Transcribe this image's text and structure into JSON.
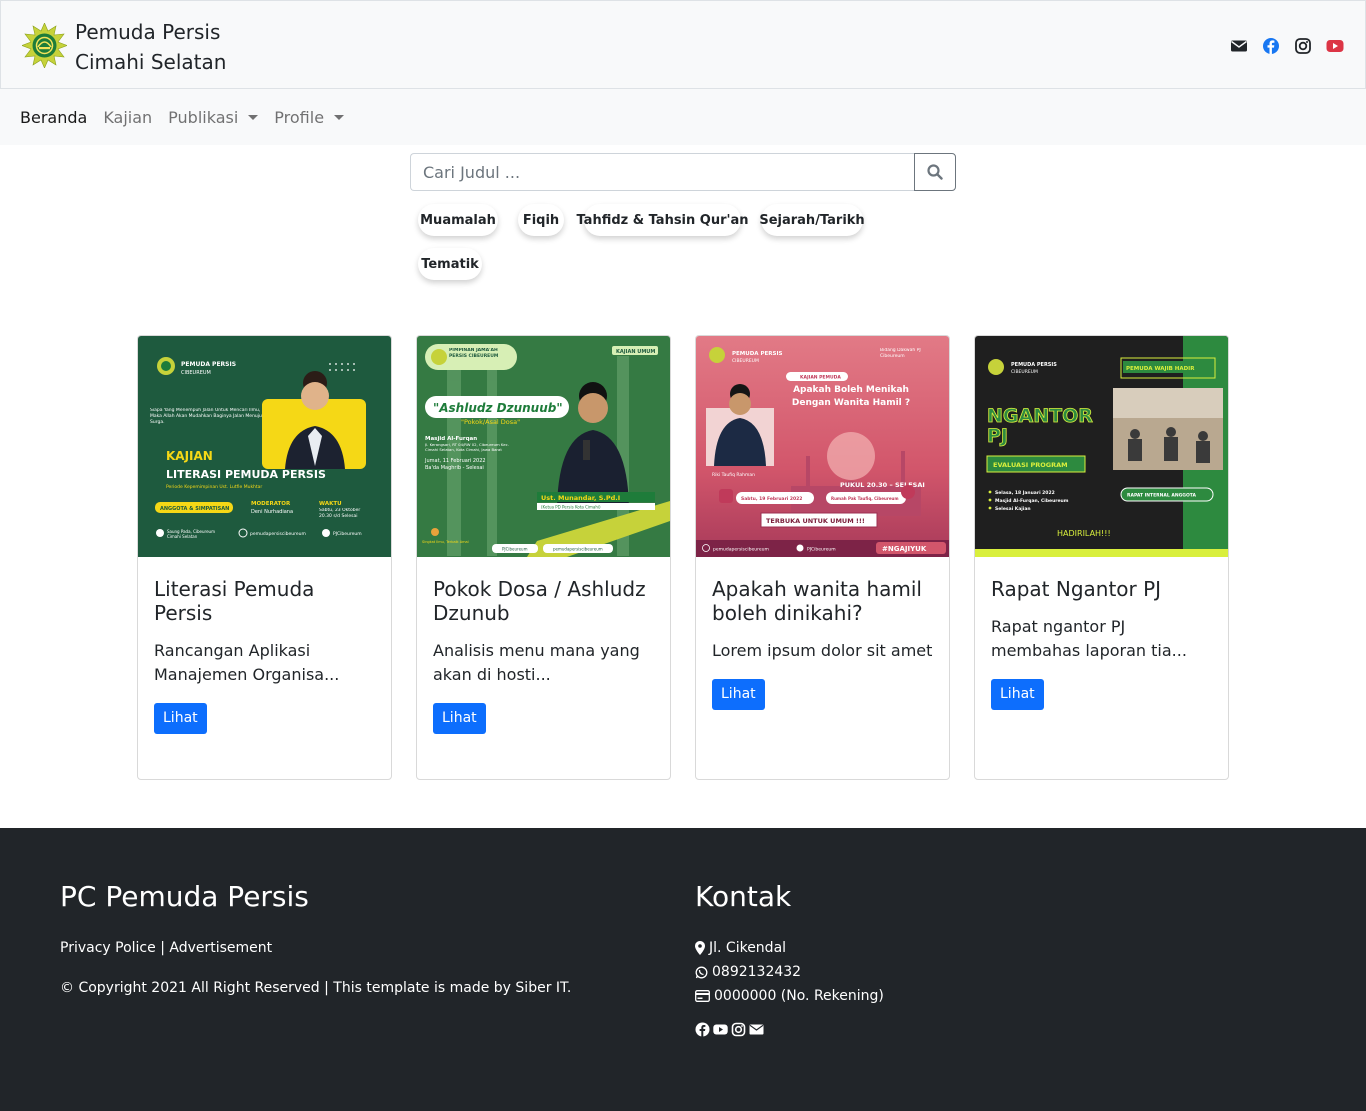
{
  "header": {
    "brand_line1": "Pemuda Persis",
    "brand_line2": "Cimahi Selatan",
    "social_icons": [
      "envelope-icon",
      "facebook-icon",
      "instagram-icon",
      "youtube-icon"
    ],
    "colors": {
      "facebook": "#1877f2",
      "youtube": "#dc3545",
      "dark": "#212529"
    }
  },
  "nav": {
    "items": [
      {
        "label": "Beranda"
      },
      {
        "label": "Kajian"
      },
      {
        "label": "Publikasi"
      },
      {
        "label": "Profile"
      }
    ]
  },
  "search": {
    "placeholder": "Cari Judul ...",
    "value": ""
  },
  "tags": [
    "Muamalah",
    "Fiqih",
    "Tahfidz & Tahsin Qur'an",
    "Sejarah/Tarikh",
    "Tematik"
  ],
  "cards": [
    {
      "title": "Literasi Pemuda Persis",
      "text": "Rancangan Aplikasi Manajemen Organisa...",
      "button": "Lihat",
      "image": {
        "org": "PEMUDA PERSIS",
        "sub": "CIBEUREUM",
        "quote": "Siapa Yang Menempuh Jalan Untuk Mencari Ilmu, Maka Allah Akan Mudahkan Baginya Jalan Menuju Surga.",
        "kajian": "KAJIAN",
        "headline": "LITERASI PEMUDA PERSIS",
        "periode": "Periode Kepemimpinan Ust. Lutfie Mukhtar",
        "audience": "ANGGOTA & SIMPATISAN",
        "moderator_label": "MODERATOR",
        "moderator": "Deni Nurhadiana",
        "waktu_label": "WAKTU",
        "waktu": "Sabtu, 23 Oktober 20.30 s/d Selesai",
        "loc": "Saung Pada, Cibeureum Cimahi Selatan",
        "ig": "pemudapersiscibeureum",
        "fb": "PJCibeureum"
      }
    },
    {
      "title": "Pokok Dosa / Ashludz Dzunub",
      "text": "Analisis menu mana yang akan di hosti...",
      "button": "Lihat",
      "image": {
        "org": "PIMPINAN JAMA'AH PERSIS CIBEUREUM",
        "badge": "KAJIAN UMUM",
        "headline": "\"Ashludz Dzunuub\"",
        "sub": "\"Pokok/Asal Dosa\"",
        "place": "Masjid Al-Furqan",
        "addr": "Jl. Kerangsari, RT 04/RW 02, Cibeureum Kec. Cimahi Selatan, Kota Cimahi, Jawa Barat",
        "date": "Jumat, 11 Februari 2022",
        "time": "Ba'da Maghrib - Selesai",
        "speaker": "Ust. Munandar, S.Pd.I",
        "speaker_role": "(Ketua PD Persis Kota Cimahi)",
        "slogan": "Singkat Ilmu, Terbaik Amal",
        "fb": "PJCibeureum",
        "ig": "pemudapersiscibeureum"
      }
    },
    {
      "title": "Apakah wanita hamil boleh dinikahi?",
      "text": "Lorem ipsum dolor sit amet",
      "button": "Lihat",
      "image": {
        "org": "PEMUDA PERSIS",
        "sub": "CIBEUREUM",
        "bidang": "Bidang Dakwah PJ Cibeureum",
        "kajian": "KAJIAN PEMUDA",
        "headline": "Apakah Boleh Menikah Dengan Wanita Hamil ?",
        "speaker": "Riki Taufiq Rahman",
        "time": "PUKUL 20.30 – SELESAI",
        "date": "Sabtu, 19 Februari 2022",
        "place": "Rumah Pak Taufiq, Cibeureum",
        "open": "TERBUKA UNTUK UMUM !!!",
        "ig": "pemudapersiscibeureum",
        "fb": "PJCibeureum",
        "hashtag": "#NGAJIYUK"
      }
    },
    {
      "title": "Rapat Ngantor PJ",
      "text": "Rapat ngantor PJ membahas laporan tia...",
      "button": "Lihat",
      "image": {
        "org": "PEMUDA PERSIS",
        "sub": "CIBEUREUM",
        "badge": "PEMUDA WAJIB HADIR",
        "headline1": "NGANTOR",
        "headline2": "PJ",
        "eval": "EVALUASI PROGRAM",
        "date": "Selasa, 18 Januari 2022",
        "place": "Masjid Al-Furqan, Cibeureum",
        "time": "Selesai Kajian",
        "rapat": "RAPAT INTERNAL ANGGOTA",
        "hadir": "HADIRILAH!!!"
      }
    }
  ],
  "footer": {
    "title": "PC Pemuda Persis",
    "link1": "Privacy Police",
    "sep": "|",
    "link2": "Advertisement",
    "copyright": "© Copyright 2021 All Right Reserved | This template is made by Siber IT.",
    "contact_title": "Kontak",
    "address": "Jl. Cikendal",
    "phone": "0892132432",
    "account": "0000000 (No. Rekening)",
    "social_icons": [
      "facebook-icon",
      "youtube-icon",
      "instagram-icon",
      "envelope-icon"
    ]
  }
}
